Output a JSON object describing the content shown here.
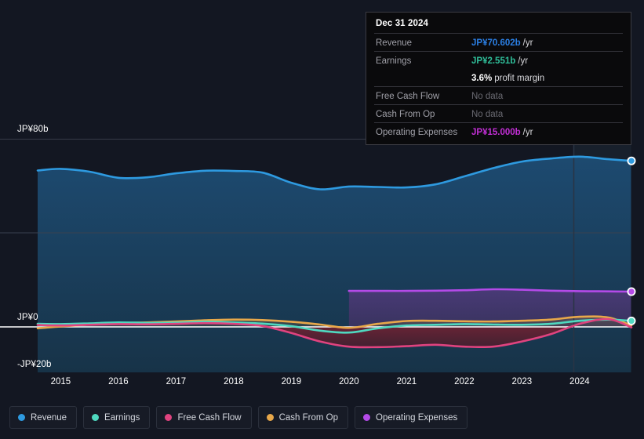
{
  "tooltip": {
    "date": "Dec 31 2024",
    "rows": [
      {
        "label": "Revenue",
        "value": "JP¥70.602b",
        "unit": "/yr",
        "color": "#2b7fe4"
      },
      {
        "label": "Earnings",
        "value": "JP¥2.551b",
        "unit": "/yr",
        "color": "#2fbf9a"
      },
      {
        "label": "",
        "value": "3.6%",
        "unit": "profit margin",
        "color": "#ffffff"
      },
      {
        "label": "Free Cash Flow",
        "value": "No data",
        "unit": "",
        "color": "#6a6a72"
      },
      {
        "label": "Cash From Op",
        "value": "No data",
        "unit": "",
        "color": "#6a6a72"
      },
      {
        "label": "Operating Expenses",
        "value": "JP¥15.000b",
        "unit": "/yr",
        "color": "#c32fd6"
      }
    ]
  },
  "legend": {
    "items": [
      {
        "label": "Revenue",
        "color": "#2e9ae0"
      },
      {
        "label": "Earnings",
        "color": "#4fd9c0"
      },
      {
        "label": "Free Cash Flow",
        "color": "#e0437f"
      },
      {
        "label": "Cash From Op",
        "color": "#e8a84a"
      },
      {
        "label": "Operating Expenses",
        "color": "#b44ae8"
      }
    ]
  },
  "axes": {
    "y_top_label": "JP¥80b",
    "y_zero_label": "JP¥0",
    "y_bottom_label": "-JP¥20b",
    "x_labels": [
      "2015",
      "2016",
      "2017",
      "2018",
      "2019",
      "2020",
      "2021",
      "2022",
      "2023",
      "2024"
    ]
  },
  "chart_data": {
    "type": "area",
    "title": "",
    "xlabel": "",
    "ylabel": "JP¥",
    "ylim": [
      -20,
      80
    ],
    "grid": true,
    "legend_position": "bottom",
    "currency": "JP¥",
    "units": "billions",
    "x_tick_labels": [
      "2015",
      "2016",
      "2017",
      "2018",
      "2019",
      "2020",
      "2021",
      "2022",
      "2023",
      "2024"
    ],
    "y_tick_labels": [
      "JP¥80b",
      "JP¥0",
      "-JP¥20b"
    ],
    "forecast_divider_year": 2023.9,
    "x": [
      2014.6,
      2015.0,
      2015.5,
      2016.0,
      2016.5,
      2017.0,
      2017.5,
      2018.0,
      2018.5,
      2019.0,
      2019.5,
      2020.0,
      2020.5,
      2021.0,
      2021.5,
      2022.0,
      2022.5,
      2023.0,
      2023.5,
      2024.0,
      2024.5,
      2024.9
    ],
    "series": [
      {
        "name": "Revenue",
        "color": "#2e9ae0",
        "values": [
          66.5,
          67.2,
          66.0,
          63.4,
          63.6,
          65.3,
          66.4,
          66.3,
          65.6,
          61.3,
          58.5,
          59.7,
          59.5,
          59.3,
          60.6,
          64.0,
          67.5,
          70.3,
          71.6,
          72.4,
          71.3,
          70.602
        ],
        "end_marker": true
      },
      {
        "name": "Earnings",
        "color": "#4fd9c0",
        "values": [
          1.3,
          1.2,
          1.5,
          1.9,
          1.7,
          1.8,
          2.2,
          1.9,
          1.4,
          0.3,
          -1.6,
          -2.4,
          -0.6,
          0.6,
          0.9,
          1.2,
          1.0,
          0.9,
          1.3,
          2.6,
          3.1,
          2.551
        ],
        "end_marker": true
      },
      {
        "name": "Free Cash Flow",
        "color": "#e0437f",
        "values": [
          0.8,
          0.6,
          0.9,
          1.2,
          1.1,
          1.3,
          1.6,
          1.3,
          0.4,
          -2.6,
          -6.2,
          -8.4,
          -8.6,
          -8.2,
          -7.6,
          -8.4,
          -8.4,
          -6.2,
          -3.1,
          1.3,
          3.3,
          -0.2
        ],
        "end_marker": false
      },
      {
        "name": "Cash From Op",
        "color": "#e8a84a",
        "values": [
          -0.6,
          0.2,
          1.0,
          1.7,
          1.9,
          2.3,
          2.8,
          3.1,
          2.9,
          2.2,
          1.0,
          -0.4,
          1.3,
          2.5,
          2.6,
          2.4,
          2.3,
          2.6,
          3.1,
          4.3,
          4.0,
          0.6
        ],
        "end_marker": false
      },
      {
        "name": "Operating Expenses",
        "color": "#b44ae8",
        "start_x": 2020.0,
        "values": [
          null,
          null,
          null,
          null,
          null,
          null,
          null,
          null,
          null,
          null,
          null,
          15.3,
          15.3,
          15.3,
          15.4,
          15.6,
          16.0,
          15.8,
          15.4,
          15.2,
          15.1,
          15.0
        ],
        "end_marker": true
      }
    ]
  }
}
